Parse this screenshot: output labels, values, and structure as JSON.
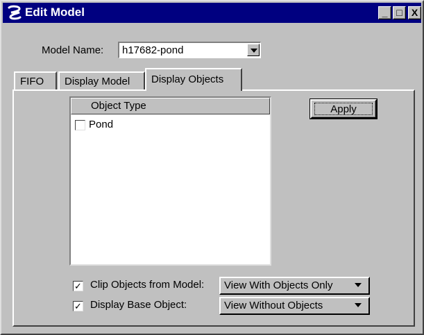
{
  "window": {
    "title": "Edit Model",
    "controls": {
      "minimize": "_",
      "maximize": "□",
      "close": "X"
    }
  },
  "model_name": {
    "label": "Model Name:",
    "value": "h17682-pond"
  },
  "tabs": [
    {
      "label": "FIFO",
      "active": false
    },
    {
      "label": "Display Model",
      "active": false
    },
    {
      "label": "Display Objects",
      "active": true
    }
  ],
  "object_list": {
    "header": "Object Type",
    "items": [
      {
        "label": "Pond",
        "checked": false
      }
    ]
  },
  "apply_button": "Apply",
  "options": {
    "clip": {
      "label": "Clip Objects from Model:",
      "checked": true,
      "check_glyph": "✓",
      "selected": "View With Objects Only"
    },
    "base": {
      "label": "Display Base Object:",
      "checked": true,
      "check_glyph": "✓",
      "selected": "View Without Objects"
    }
  },
  "colors": {
    "titlebar": "#000080",
    "face": "#c0c0c0"
  },
  "icons": {
    "app": "microstation-logo-icon",
    "dropdown": "chevron-down-icon"
  }
}
